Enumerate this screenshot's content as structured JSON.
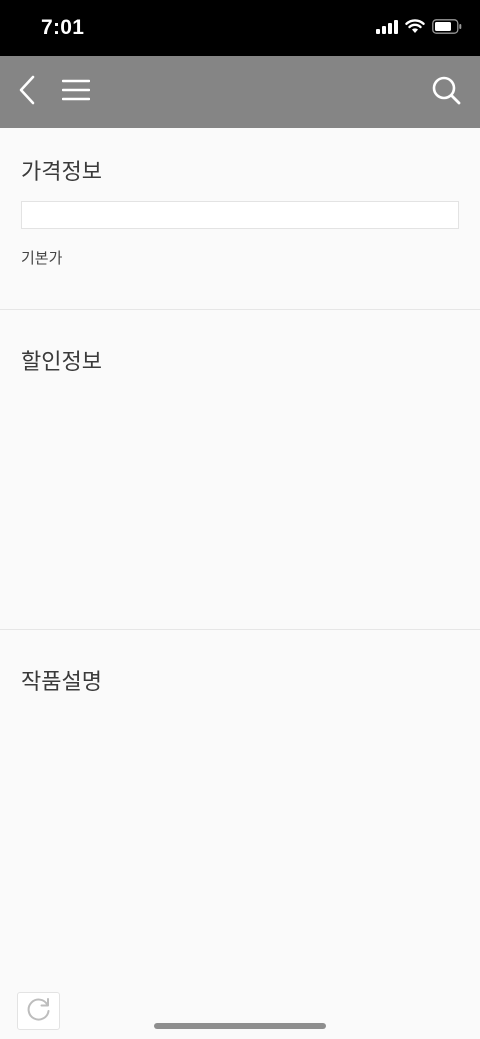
{
  "status_bar": {
    "time": "7:01",
    "icons": [
      "signal-icon",
      "wifi-icon",
      "battery-icon"
    ]
  },
  "nav_bar": {
    "background": "#858585",
    "icons": [
      "back-chevron-icon",
      "hamburger-menu-icon",
      "search-icon"
    ]
  },
  "sections": {
    "price": {
      "title": "가격정보",
      "input_value": "",
      "label": "기본가"
    },
    "discount": {
      "title": "할인정보"
    },
    "description": {
      "title": "작품설명"
    }
  },
  "floating": {
    "refresh_icon": "refresh-icon"
  }
}
